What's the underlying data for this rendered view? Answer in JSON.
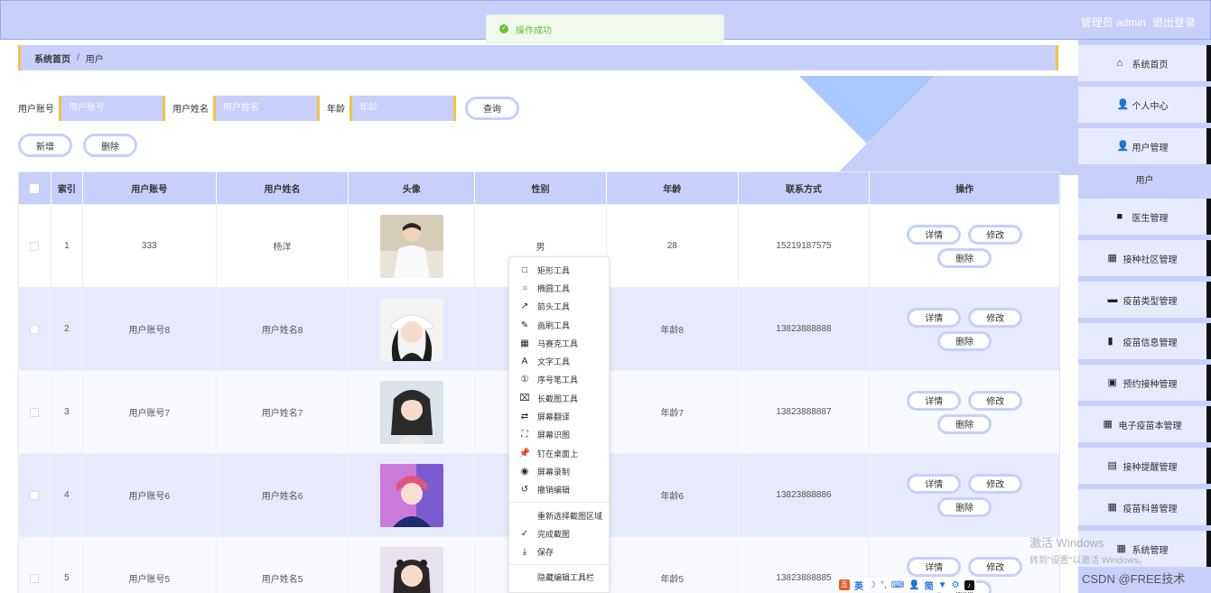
{
  "topbar": {
    "user_label": "管理员 admin",
    "logout_label": "退出登录"
  },
  "toast": {
    "message": "操作成功"
  },
  "breadcrumb": {
    "home": "系统首页",
    "separator": "/",
    "current": "用户"
  },
  "search": {
    "account_label": "用户账号",
    "account_placeholder": "用户账号",
    "name_label": "用户姓名",
    "name_placeholder": "用户姓名",
    "age_label": "年龄",
    "age_placeholder": "年龄",
    "query_label": "查询"
  },
  "actions": {
    "add_label": "新增",
    "delete_label": "删除"
  },
  "table": {
    "headers": [
      "索引",
      "用户账号",
      "用户姓名",
      "头像",
      "性别",
      "年龄",
      "联系方式",
      "操作"
    ],
    "rows": [
      {
        "index": "1",
        "account": "333",
        "name": "杨洋",
        "gender": "男",
        "age": "28",
        "phone": "15219187575"
      },
      {
        "index": "2",
        "account": "用户账号8",
        "name": "用户姓名8",
        "gender": "",
        "age": "年龄8",
        "phone": "13823888888"
      },
      {
        "index": "3",
        "account": "用户账号7",
        "name": "用户姓名7",
        "gender": "",
        "age": "年龄7",
        "phone": "13823888887"
      },
      {
        "index": "4",
        "account": "用户账号6",
        "name": "用户姓名6",
        "gender": "",
        "age": "年龄6",
        "phone": "13823888886"
      },
      {
        "index": "5",
        "account": "用户账号5",
        "name": "用户姓名5",
        "gender": "",
        "age": "年龄5",
        "phone": "13823888885"
      }
    ],
    "op_detail": "详情",
    "op_edit": "修改",
    "op_delete": "删除"
  },
  "sidebar": {
    "items": [
      {
        "label": "系统首页",
        "icon": "home-icon"
      },
      {
        "label": "个人中心",
        "icon": "user-icon"
      },
      {
        "label": "用户管理",
        "icon": "user-manage-icon"
      },
      {
        "label": "医生管理",
        "icon": "doctor-icon"
      },
      {
        "label": "接种社区管理",
        "icon": "grid-icon"
      },
      {
        "label": "疫苗类型管理",
        "icon": "monitor-icon"
      },
      {
        "label": "疫苗信息管理",
        "icon": "bar-chart-icon"
      },
      {
        "label": "预约接种管理",
        "icon": "printer-icon"
      },
      {
        "label": "电子疫苗本管理",
        "icon": "grid-icon"
      },
      {
        "label": "接种提醒管理",
        "icon": "clipboard-icon"
      },
      {
        "label": "疫苗科普管理",
        "icon": "grid-icon"
      },
      {
        "label": "系统管理",
        "icon": "grid-icon"
      }
    ],
    "submenu_label": "用户"
  },
  "context_menu": {
    "items": [
      {
        "label": "矩形工具",
        "icon": "□"
      },
      {
        "label": "椭圆工具",
        "icon": "○"
      },
      {
        "label": "箭头工具",
        "icon": "↗"
      },
      {
        "label": "画刷工具",
        "icon": "✎"
      },
      {
        "label": "马赛克工具",
        "icon": "▦"
      },
      {
        "label": "文字工具",
        "icon": "A"
      },
      {
        "label": "序号笔工具",
        "icon": "①"
      },
      {
        "label": "长截图工具",
        "icon": "⌧"
      },
      {
        "label": "屏幕翻译",
        "icon": "⇄"
      },
      {
        "label": "屏幕识图",
        "icon": "⛶"
      },
      {
        "label": "钉在桌面上",
        "icon": "📌"
      },
      {
        "label": "屏幕录制",
        "icon": "◉"
      },
      {
        "label": "撤销编辑",
        "icon": "↺"
      }
    ],
    "items2": [
      {
        "label": "重新选择截图区域",
        "icon": ""
      },
      {
        "label": "完成截图",
        "icon": "✓"
      },
      {
        "label": "保存",
        "icon": "⤓"
      }
    ],
    "items3": [
      {
        "label": "隐藏编辑工具栏",
        "icon": ""
      }
    ]
  },
  "watermark": {
    "line1": "激活 Windows",
    "line2": "转到\"设置\"以激活 Windows。"
  },
  "csdn": "CSDN @FREE技术",
  "ime": {
    "lang": "英",
    "mode": "简"
  },
  "colors": {
    "primary": "#c6d0fb",
    "accent_border": "#f5c242",
    "row_alt": "#e6eafc"
  }
}
